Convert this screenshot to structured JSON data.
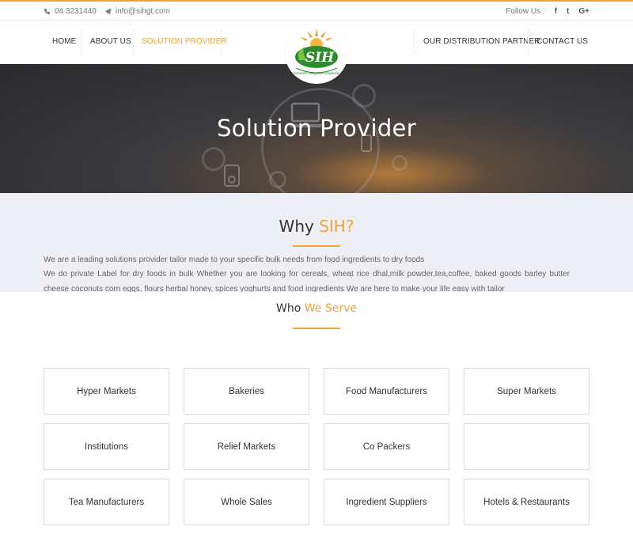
{
  "topbar": {
    "phone": "04 3231440",
    "email": "info@sihgt.com",
    "follow_label": "Follow Us :",
    "social": [
      {
        "icon": "facebook-icon",
        "glyph": "f"
      },
      {
        "icon": "twitter-icon",
        "glyph": "t"
      },
      {
        "icon": "google-plus-icon",
        "glyph": "G+"
      }
    ]
  },
  "nav": {
    "home": "HOME",
    "about": "ABOUT US",
    "solution": "SOLUTION PROVIDER",
    "distribution": "OUR DISTRIBUTION PARTNER",
    "contact": "CONTACT US",
    "active_color": "#f0a33a"
  },
  "logo": {
    "text": "SIH",
    "tagline": "Solutions Integrated Hospitality"
  },
  "hero": {
    "title": "Solution Provider"
  },
  "why": {
    "title_prefix": "Why",
    "title_highlight": "SIH?",
    "para1": "We are a leading solutions provider tailor made to your specific bulk needs from food ingredients to dry foods",
    "para2": "We do private Label for dry foods in bulk Whether you are looking for cereals, wheat rice dhal,milk powder,tea,coffee, baked goods barley butter cheese coconuts corn eggs, flours herbal honey, spices yoghurts and food ingredients We are here to make your life easy with tailor"
  },
  "serve": {
    "title_prefix": "Who",
    "title_highlight": "We Serve",
    "items": [
      "Hyper Markets",
      "Bakeries",
      "Food Manufacturers",
      "Super Markets",
      "Institutions",
      "Relief Markets",
      "Co Packers",
      "",
      "Tea Manufacturers",
      "Whole Sales",
      "Ingredient Suppliers",
      "Hotels & Restaurants"
    ]
  },
  "colors": {
    "accent": "#f0a33a",
    "brand_green": "#2e8b2e"
  }
}
